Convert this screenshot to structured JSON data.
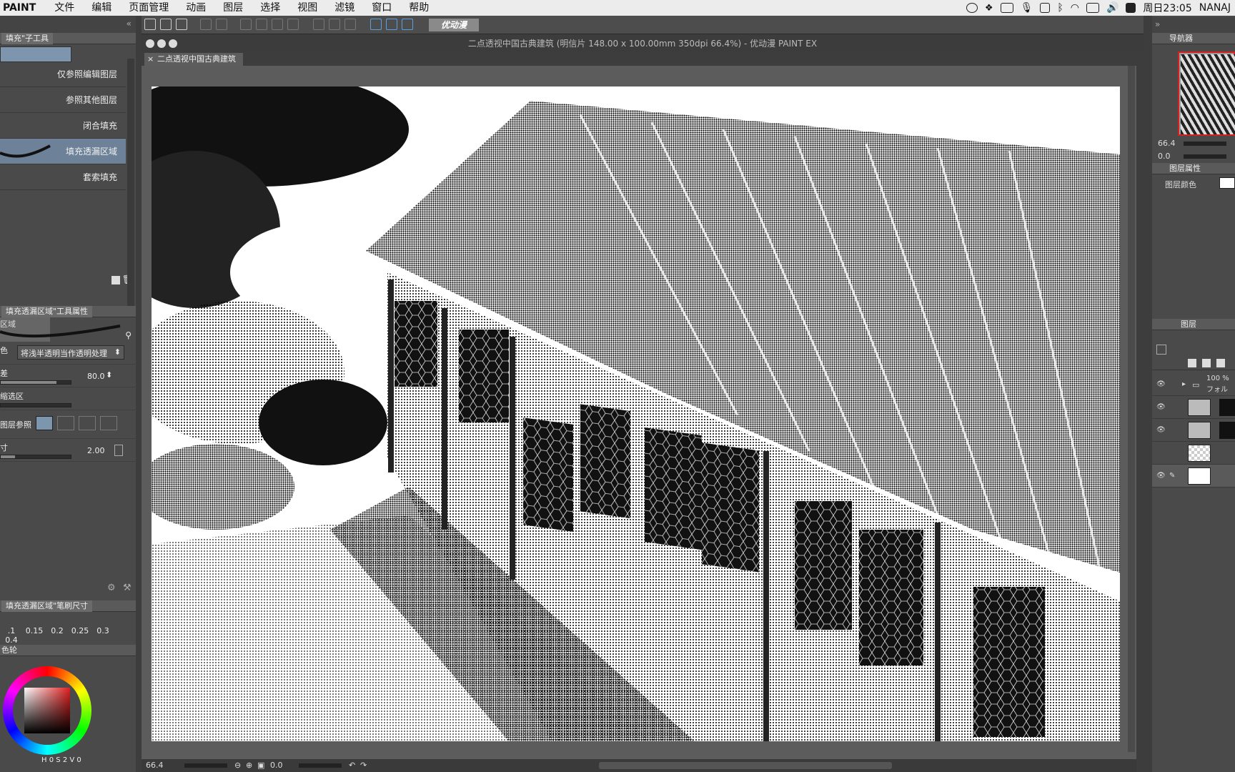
{
  "menubar": {
    "app_name": "PAINT",
    "items": [
      "文件",
      "编辑",
      "页面管理",
      "动画",
      "图层",
      "选择",
      "视图",
      "滤镜",
      "窗口",
      "帮助"
    ],
    "clock": "周日23:05",
    "user": "NANAJ"
  },
  "left_panel": {
    "subtool_header": "填充\"子工具",
    "subtools": [
      "仅参照编辑图层",
      "参照其他图层",
      "闭合填充",
      "填充透漏区域",
      "套索填充"
    ],
    "tool_property_header": "填充透漏区域\"工具属性",
    "tool_name_fragment": "区域",
    "color_label": "色",
    "color_mode_value": "将浅半透明当作透明处理",
    "tolerance_label": "差",
    "tolerance_value": "80.0",
    "tolerance_fraction": 0.8,
    "expand_label": "缩选区",
    "layer_ref_label": "图层参照",
    "size_label": "寸",
    "size_value": "2.00",
    "size_fraction": 0.2,
    "brush_size_header": "填充透漏区域\"笔刷尺寸",
    "brush_sizes": [
      ".1",
      "0.15",
      "0.2",
      "0.25",
      "0.3",
      "0.4"
    ],
    "color_wheel_label": "色轮",
    "hsv": {
      "h_label": "H",
      "h": "0",
      "s_label": "S",
      "s": "2",
      "v_label": "V",
      "v": "0"
    }
  },
  "toolbar": {
    "logo_text": "优动漫"
  },
  "document": {
    "window_title": "二点透视中国古典建筑 (明信片 148.00 x 100.00mm 350dpi 66.4%) - 优动漫 PAINT EX",
    "tab_label": "二点透视中国古典建筑"
  },
  "status": {
    "zoom": "66.4",
    "rotation": "0.0"
  },
  "right_panel": {
    "navigator_label": "导航器",
    "zoom_value": "66.4",
    "rotation_value": "0.0",
    "layer_props_label": "图层属性",
    "layer_color_label": "图层颜色",
    "layers_label": "图层",
    "folder_opacity": "100 %",
    "folder_name": "フォル"
  },
  "colors": {
    "accent_blue": "#6d8299",
    "selection_border": "#d21f1f"
  }
}
